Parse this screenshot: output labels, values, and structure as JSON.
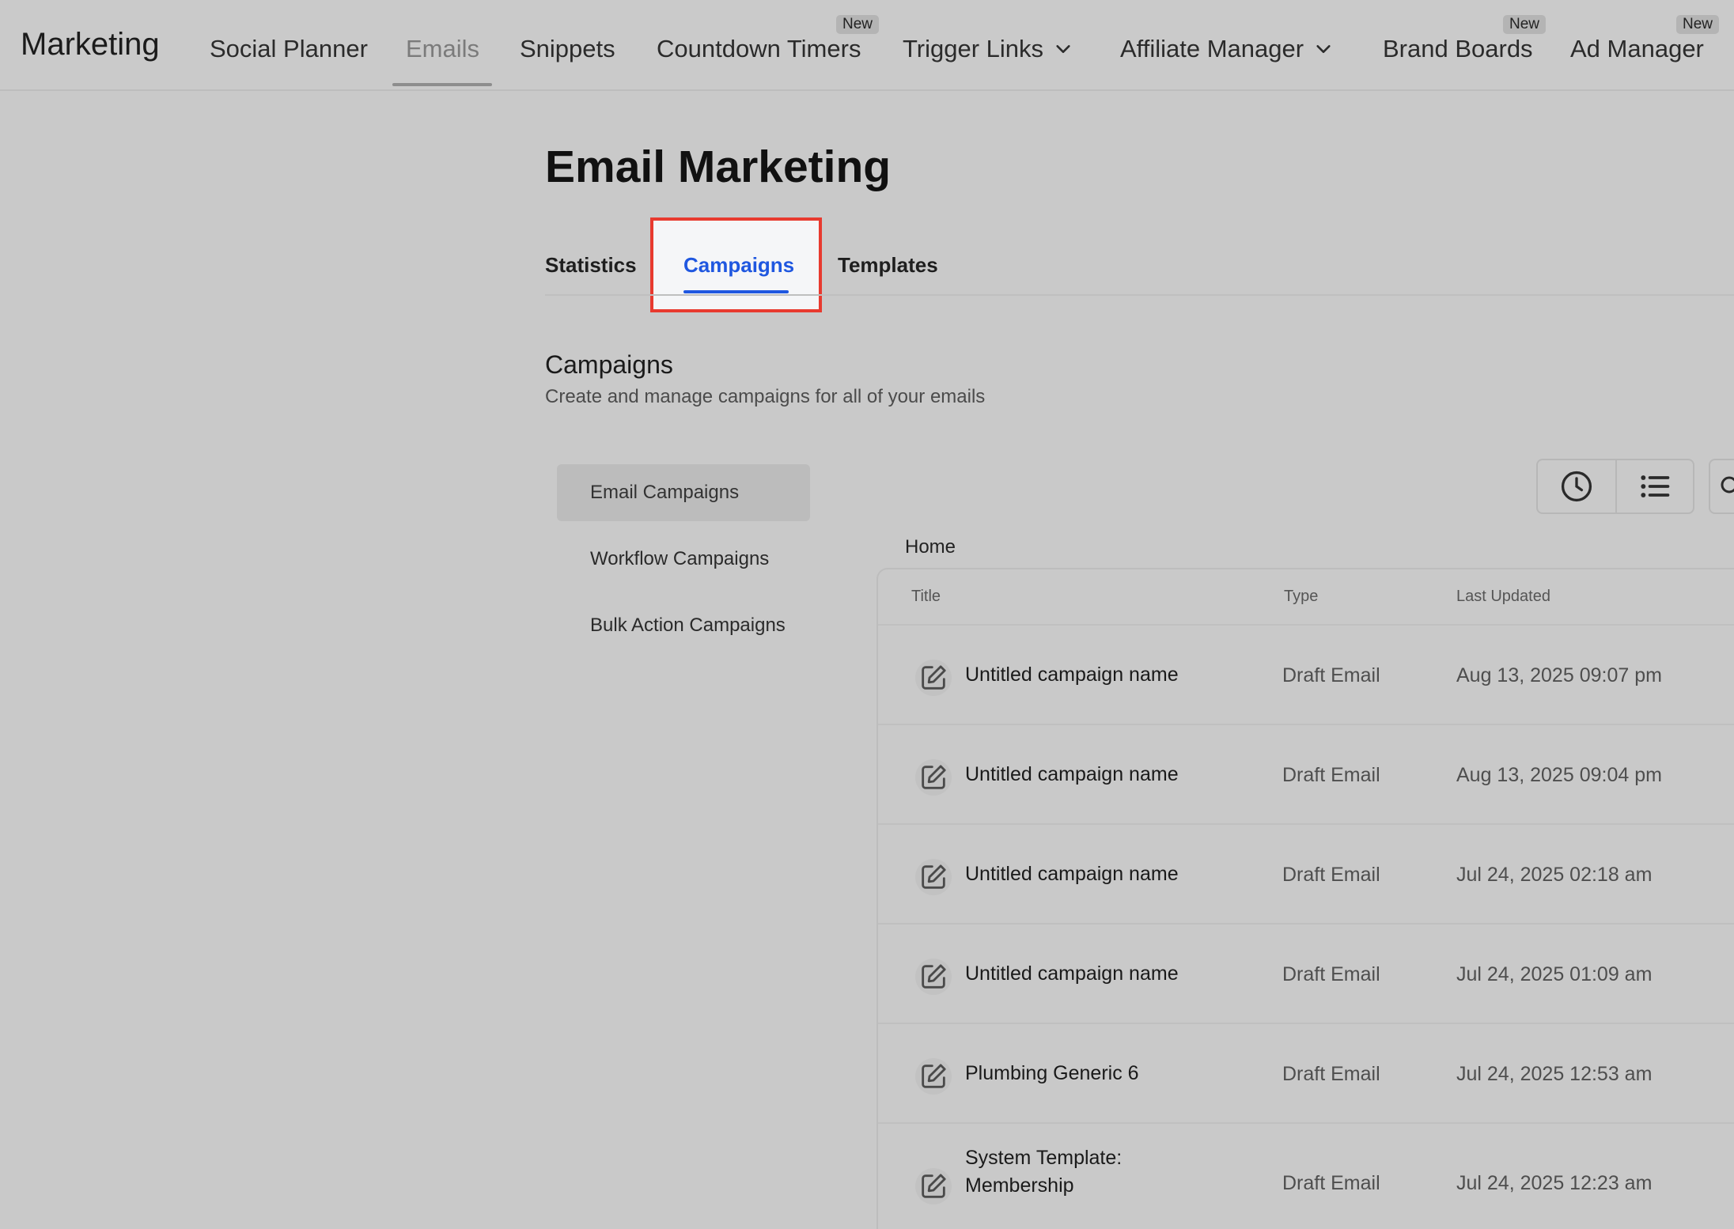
{
  "topnav": {
    "brand": "Marketing",
    "items": [
      {
        "label": "Social Planner"
      },
      {
        "label": "Emails"
      },
      {
        "label": "Snippets"
      },
      {
        "label": "Countdown Timers",
        "badge": "New"
      },
      {
        "label": "Trigger Links"
      },
      {
        "label": "Affiliate Manager"
      },
      {
        "label": "Brand Boards",
        "badge": "New"
      },
      {
        "label": "Ad Manager",
        "badge": "New"
      }
    ]
  },
  "page": {
    "title": "Email Marketing",
    "tabs": [
      {
        "label": "Statistics"
      },
      {
        "label": "Campaigns"
      },
      {
        "label": "Templates"
      }
    ]
  },
  "section": {
    "title": "Campaigns",
    "subtitle": "Create and manage campaigns for all of your emails"
  },
  "sidemenu": {
    "items": [
      {
        "label": "Email Campaigns"
      },
      {
        "label": "Workflow Campaigns"
      },
      {
        "label": "Bulk Action Campaigns"
      }
    ]
  },
  "breadcrumb": "Home",
  "table": {
    "columns": [
      "Title",
      "Type",
      "Last Updated"
    ],
    "rows": [
      {
        "title": "Untitled campaign name",
        "type": "Draft Email",
        "updated": "Aug 13, 2025 09:07 pm"
      },
      {
        "title": "Untitled campaign name",
        "type": "Draft Email",
        "updated": "Aug 13, 2025 09:04 pm"
      },
      {
        "title": "Untitled campaign name",
        "type": "Draft Email",
        "updated": "Jul 24, 2025 02:18 am"
      },
      {
        "title": "Untitled campaign name",
        "type": "Draft Email",
        "updated": "Jul 24, 2025 01:09 am"
      },
      {
        "title": "Plumbing Generic 6",
        "type": "Draft Email",
        "updated": "Jul 24, 2025 12:53 am"
      },
      {
        "title": "System Template: Membership",
        "type": "Draft Email",
        "updated": "Jul 24, 2025 12:23 am"
      }
    ]
  },
  "colors": {
    "accent": "#1f57e0",
    "highlight": "#e83a2f",
    "background": "#c9c9c9"
  },
  "icons": {
    "history": "clock-icon",
    "list_view": "list-icon",
    "row_edit": "edit-icon",
    "dropdown": "chevron-down-icon"
  }
}
